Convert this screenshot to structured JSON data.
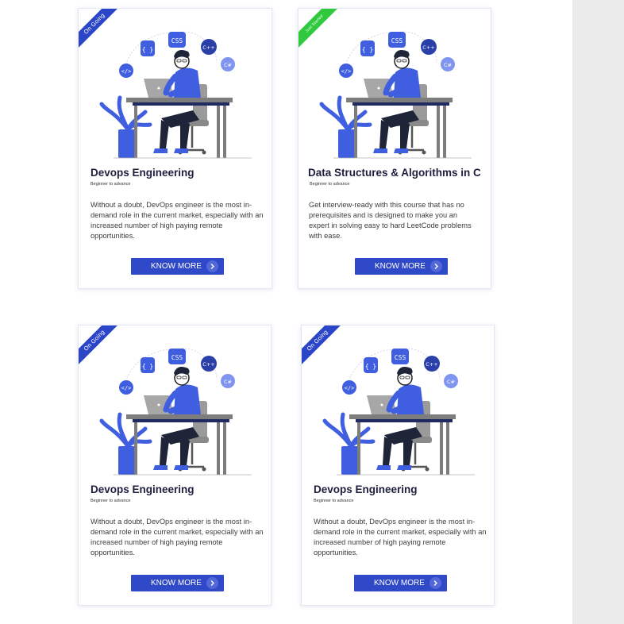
{
  "cards": [
    {
      "ribbon": "On Going",
      "title": "Devops Engineering",
      "level": "Beginner to advance",
      "description": "Without a doubt, DevOps engineer is the most in-demand role in the current market, especially with an increased number of high paying remote opportunities.",
      "button_label": "KNOW MORE",
      "illustration": [
        "CSS",
        "C++",
        "C#",
        "{ }",
        "</>"
      ]
    },
    {
      "ribbon": "Just Started",
      "title": "Data Structures & Algorithms in C",
      "level": "Beginner to advance",
      "description": "Get interview-ready with this course that has no prerequisites and is designed to make you an expert in solving easy to hard LeetCode problems with ease.",
      "button_label": "KNOW MORE",
      "illustration": [
        "CSS",
        "C++",
        "C#",
        "{ }",
        "</>"
      ]
    },
    {
      "ribbon": "On Going",
      "title": "Devops Engineering",
      "level": "Beginner to advance",
      "description": "Without a doubt, DevOps engineer is the most in-demand role in the current market, especially with an increased number of high paying remote opportunities.",
      "button_label": "KNOW MORE",
      "illustration": [
        "CSS",
        "C++",
        "C#",
        "{ }",
        "</>"
      ]
    },
    {
      "ribbon": "On Going",
      "title": "Devops Engineering",
      "level": "Beginner to advance",
      "description": "Without a doubt, DevOps engineer is the most in-demand role in the current market, especially with an increased number of high paying remote opportunities.",
      "button_label": "KNOW MORE",
      "illustration": [
        "CSS",
        "C++",
        "C#",
        "{ }",
        "</>"
      ]
    }
  ],
  "colors": {
    "accent": "#2f49c8",
    "ribbon_ongoing": "#2b45c9",
    "ribbon_started": "#2fc93d",
    "title": "#1d1f3e"
  }
}
